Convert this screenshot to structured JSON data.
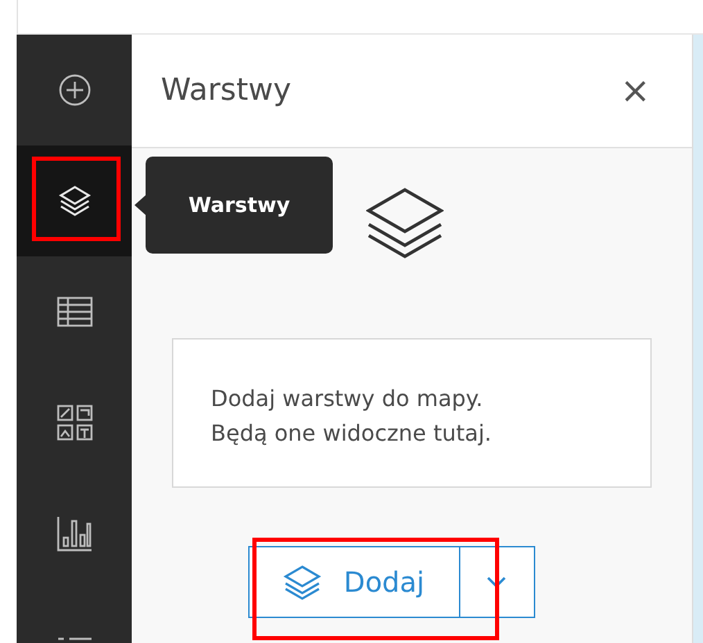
{
  "sidebar": {
    "items": [
      {
        "kind": "add",
        "selected": false
      },
      {
        "kind": "layers",
        "selected": true
      },
      {
        "kind": "table",
        "selected": false
      },
      {
        "kind": "widgets",
        "selected": false
      },
      {
        "kind": "chart",
        "selected": false
      },
      {
        "kind": "list",
        "selected": false
      }
    ]
  },
  "tooltip": {
    "text": "Warstwy"
  },
  "panel": {
    "title": "Warstwy",
    "close": "×",
    "message": "Dodaj warstwy do mapy. Będą one widoczne tutaj.",
    "add_button": {
      "label": "Dodaj"
    }
  }
}
